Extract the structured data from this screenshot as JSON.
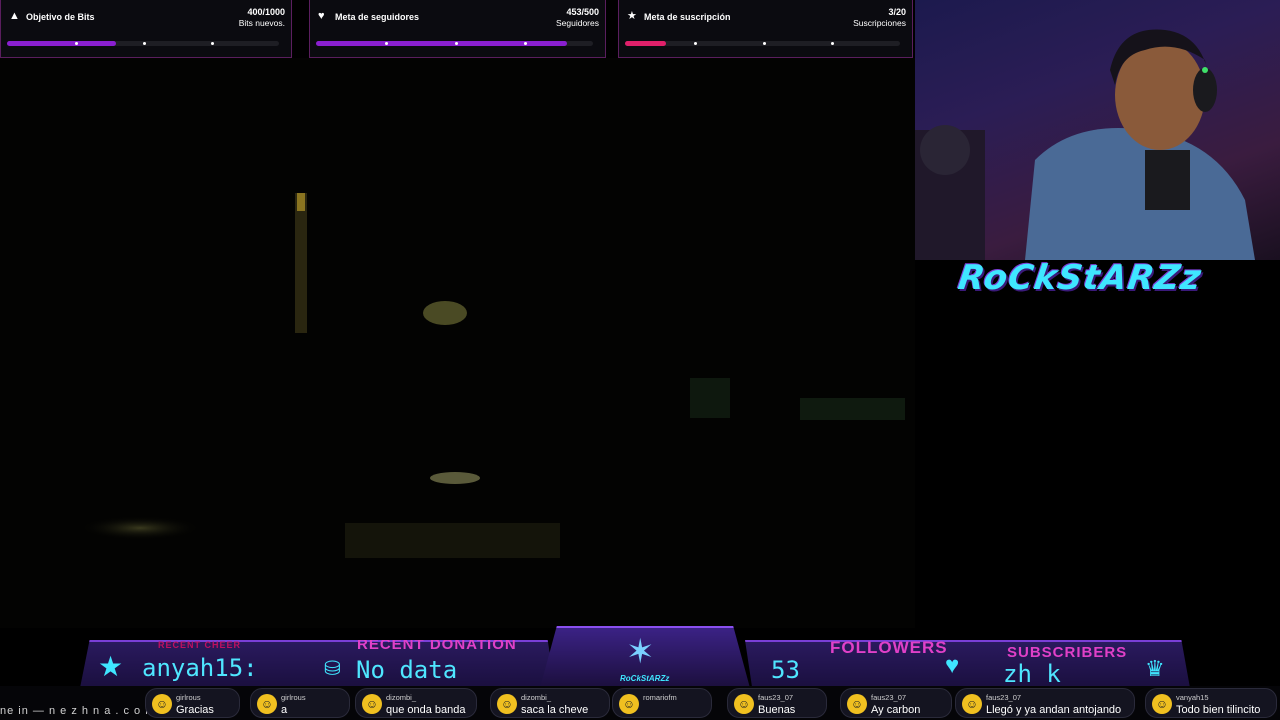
{
  "goals": [
    {
      "icon": "bits-icon",
      "title": "Objetivo de Bits",
      "value": "400/1000",
      "sub": "Bits nuevos.",
      "fill_fraction": 0.4,
      "color": "#8a1fd0"
    },
    {
      "icon": "heart-icon",
      "title": "Meta de seguidores",
      "value": "453/500",
      "sub": "Seguidores",
      "fill_fraction": 0.906,
      "color": "#8a1fd0"
    },
    {
      "icon": "star-icon",
      "title": "Meta de suscripción",
      "value": "3/20",
      "sub": "Suscripciones",
      "fill_fraction": 0.15,
      "color": "#e0206a"
    }
  ],
  "logo_text": "RoCkStARZz",
  "bottom": {
    "recent_cheer": {
      "label": "RECENT CHEER",
      "value": "anyah15:"
    },
    "recent_donation": {
      "label": "RECENT DONATION",
      "value": "No data"
    },
    "followers": {
      "label": "FOLLOWERS",
      "value": "53"
    },
    "subscribers": {
      "label": "SUBSCRIBERS",
      "value": "zh_k"
    },
    "center_logo": "RoCkStARZz"
  },
  "ticker": "ne in — n e z h n a . c o m",
  "chat": [
    {
      "user": "girlrous",
      "text": "Gracias"
    },
    {
      "user": "girlrous",
      "text": "a"
    },
    {
      "user": "dizombi_",
      "text": "que onda banda"
    },
    {
      "user": "dizombi_",
      "text": "saca la cheve"
    },
    {
      "user": "romariofm",
      "text": ""
    },
    {
      "user": "faus23_07",
      "text": "Buenas"
    },
    {
      "user": "faus23_07",
      "text": "Ay carbon"
    },
    {
      "user": "faus23_07",
      "text": "Llegó y ya andan antojando"
    },
    {
      "user": "vanyah15",
      "text": "Todo bien tilincito"
    }
  ]
}
